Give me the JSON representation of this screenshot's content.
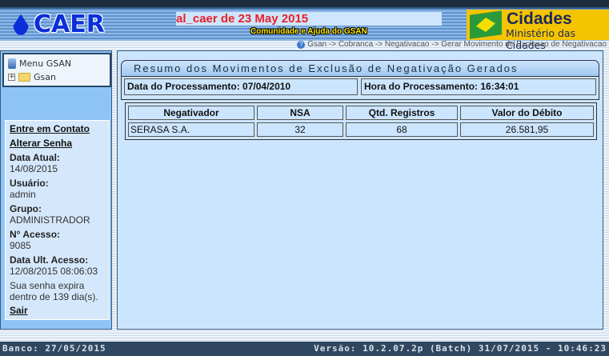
{
  "header": {
    "logo": "CAER",
    "marquee": "al_caer de 23 May 2015",
    "help_link": "Comunidade e Ajuda do GSAN",
    "cidades_title": "Cidades",
    "cidades_subtitle": "Ministério das Cidades"
  },
  "breadcrumb": "Gsan -> Cobranca -> Negativacao -> Gerar Movimento de Exclusao de Negativacao",
  "menu": {
    "title": "Menu GSAN",
    "root": "Gsan"
  },
  "info": {
    "contact": "Entre em Contato",
    "change_password": "Alterar Senha",
    "date_label": "Data Atual:",
    "date": "14/08/2015",
    "user_label": "Usuário:",
    "user": "admin",
    "group_label": "Grupo:",
    "group": "ADMINISTRADOR",
    "access_label": "N° Acesso:",
    "access": "9085",
    "last_label": "Data Ult. Acesso:",
    "last": "12/08/2015 08:06:03",
    "expire": "Sua senha expira dentro de 139 dia(s).",
    "logout": "Sair"
  },
  "main": {
    "title": "Resumo dos Movimentos de Exclusão de Negativação Gerados",
    "date": "Data do Processamento: 07/04/2010",
    "time": "Hora do Processamento: 16:34:01",
    "columns": [
      "Negativador",
      "NSA",
      "Qtd. Registros",
      "Valor do Débito"
    ],
    "rows": [
      [
        "SERASA S.A.",
        "32",
        "68",
        "26.581,95"
      ]
    ]
  },
  "footer": {
    "db": "Banco: 27/05/2015",
    "version": "Versão: 10.2.07.2p (Batch) 31/07/2015 - 10:46:23"
  }
}
